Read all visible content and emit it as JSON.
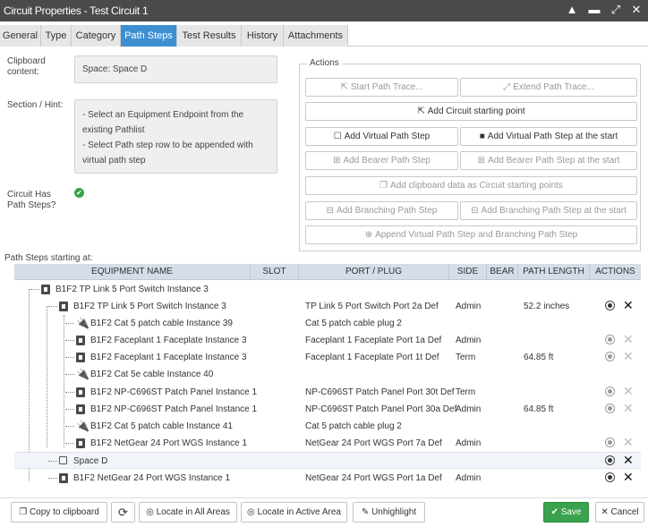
{
  "window": {
    "title": "Circuit Properties - Test Circuit 1"
  },
  "tabs": [
    "General",
    "Type",
    "Category",
    "Path Steps",
    "Test Results",
    "History",
    "Attachments"
  ],
  "active_tab": "Path Steps",
  "form": {
    "clipboard_label_1": "Clipboard",
    "clipboard_label_2": "content:",
    "clipboard_value": "Space: Space D",
    "hint_label": "Section / Hint:",
    "hint_lines": [
      "- Select an Equipment Endpoint from the",
      "existing Pathlist",
      "- Select Path step row to be appended with",
      "virtual path step"
    ],
    "has_steps_label_1": "Circuit Has",
    "has_steps_label_2": "Path Steps?",
    "has_steps_value": "✔"
  },
  "actions": {
    "legend": "Actions",
    "start_trace": "Start Path Trace...",
    "extend_trace": "Extend Path Trace...",
    "add_start_point": "Add Circuit starting point",
    "add_virtual": "Add Virtual Path Step",
    "add_virtual_start": "Add Virtual Path Step at the start",
    "add_bearer": "Add Bearer Path Step",
    "add_bearer_start": "Add Bearer Path Step at the start",
    "add_clipboard": "Add clipboard data as Circuit starting points",
    "add_branching": "Add Branching Path Step",
    "add_branching_start": "Add Branching Path Step at the start",
    "append_virtual_branching": "Append Virtual Path Step and Branching Path Step"
  },
  "grid": {
    "section_label": "Path Steps starting at:",
    "columns": [
      "EQUIPMENT NAME",
      "SLOT",
      "PORT / PLUG",
      "SIDE",
      "BEAR",
      "PATH LENGTH",
      "ACTIONS"
    ],
    "rows": [
      {
        "name": "B1F2 TP Link 5 Port Switch Instance 3",
        "port": "",
        "side": "",
        "length": "",
        "icon": "device",
        "actions": false
      },
      {
        "name": "B1F2 TP Link 5 Port Switch Instance 3",
        "port": "TP Link 5 Port Switch Port 2a Def",
        "side": "Admin",
        "length": "52.2 inches",
        "icon": "device",
        "actions": true,
        "dim": false
      },
      {
        "name": "B1F2 Cat 5 patch cable Instance 39",
        "port": "Cat 5 patch cable plug 2",
        "side": "",
        "length": "",
        "icon": "plug",
        "actions": false
      },
      {
        "name": "B1F2 Faceplant 1 Faceplate Instance 3",
        "port": "Faceplant 1 Faceplate Port 1a Def",
        "side": "Admin",
        "length": "",
        "icon": "device",
        "actions": true,
        "dim": true
      },
      {
        "name": "B1F2 Faceplant 1 Faceplate Instance 3",
        "port": "Faceplant 1 Faceplate Port 1t Def",
        "side": "Term",
        "length": "64.85 ft",
        "icon": "device",
        "actions": true,
        "dim": true
      },
      {
        "name": "B1F2 Cat 5e cable Instance 40",
        "port": "",
        "side": "",
        "length": "",
        "icon": "plug",
        "actions": false
      },
      {
        "name": "B1F2 NP-C696ST Patch Panel Instance 1",
        "port": "NP-C696ST Patch Panel Port 30t Def",
        "side": "Term",
        "length": "",
        "icon": "device",
        "actions": true,
        "dim": true
      },
      {
        "name": "B1F2 NP-C696ST Patch Panel Instance 1",
        "port": "NP-C696ST Patch Panel Port 30a Def",
        "side": "Admin",
        "length": "64.85 ft",
        "icon": "device",
        "actions": true,
        "dim": true
      },
      {
        "name": "B1F2 Cat 5 patch cable Instance 41",
        "port": "Cat 5 patch cable plug 2",
        "side": "",
        "length": "",
        "icon": "plug",
        "actions": false
      },
      {
        "name": "B1F2 NetGear 24 Port WGS Instance 1",
        "port": "NetGear 24 Port WGS Port 7a Def",
        "side": "Admin",
        "length": "",
        "icon": "device",
        "actions": true,
        "dim": true
      },
      {
        "name": "Space D",
        "port": "",
        "side": "",
        "length": "",
        "icon": "square",
        "actions": true,
        "dim": false
      },
      {
        "name": "B1F2 NetGear 24 Port WGS Instance 1",
        "port": "NetGear 24 Port WGS Port 1a Def",
        "side": "Admin",
        "length": "",
        "icon": "device",
        "actions": true,
        "dim": false
      }
    ]
  },
  "footer": {
    "copy": "Copy to clipboard",
    "locate_all": "Locate in All Areas",
    "locate_active": "Locate in Active Area",
    "unhighlight": "Unhighlight",
    "save": "Save",
    "cancel": "Cancel"
  },
  "colors": {
    "title_bar": "#4a4a4a",
    "active_tab": "#3d8fd1",
    "save_button": "#3aa24c",
    "grid_header": "#d5dde8"
  }
}
